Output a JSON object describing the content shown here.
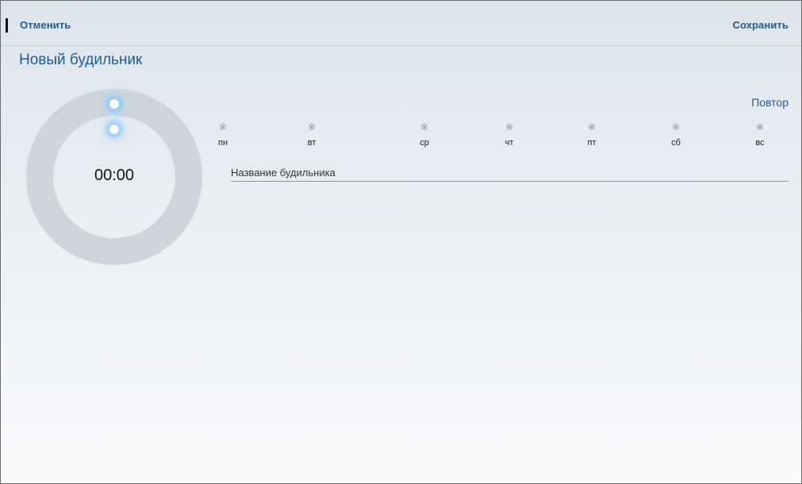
{
  "header": {
    "cancel_label": "Отменить",
    "save_label": "Сохранить"
  },
  "title": "Новый будильник",
  "dial": {
    "time": "00:00"
  },
  "repeat": {
    "label": "Повтор",
    "days": [
      {
        "label": "пн",
        "icon": "day-dot-icon"
      },
      {
        "label": "вт",
        "icon": "day-dot-icon"
      },
      {
        "label": "ср",
        "icon": "day-dot-icon"
      },
      {
        "label": "чт",
        "icon": "day-dot-icon"
      },
      {
        "label": "пт",
        "icon": "day-dot-icon"
      },
      {
        "label": "сб",
        "icon": "day-dot-icon"
      },
      {
        "label": "вс",
        "icon": "day-dot-icon"
      }
    ]
  },
  "alarm_name": {
    "placeholder": "Название будильника",
    "value": ""
  },
  "colors": {
    "accent": "#1b5d97",
    "dial_ring": "#cfd5db",
    "knob_glow": "#82c8fa"
  }
}
